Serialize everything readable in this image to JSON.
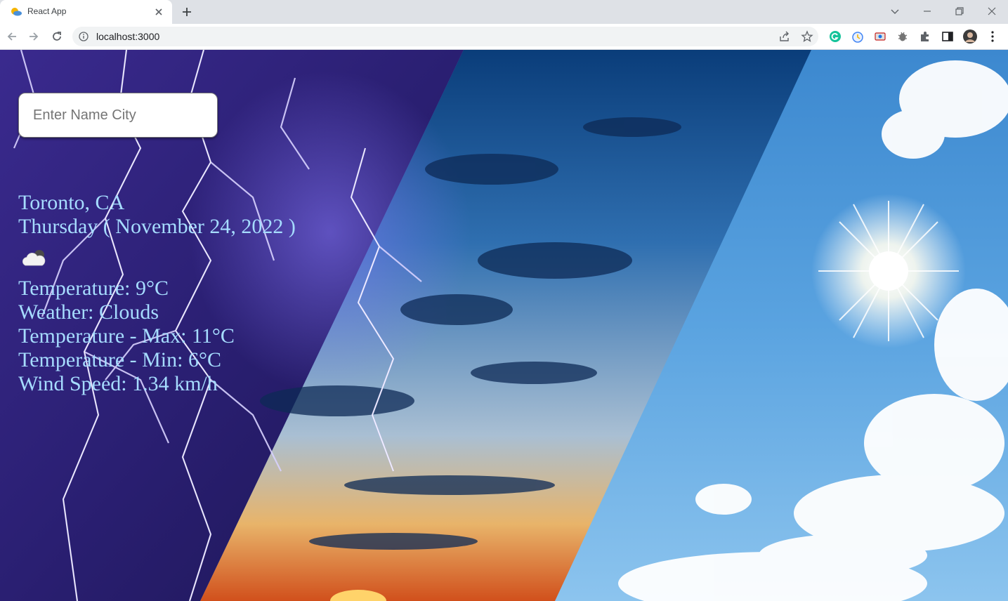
{
  "browser": {
    "tab_title": "React App",
    "url": "localhost:3000"
  },
  "search": {
    "placeholder": "Enter Name City",
    "value": ""
  },
  "weather": {
    "location": "Toronto, CA",
    "date": "Thursday ( November 24, 2022 )",
    "icon": "cloud-icon",
    "temperature": "Temperature: 9°C",
    "condition": "Weather: Clouds",
    "temp_max": "Temperature - Max: 11°C",
    "temp_min": "Temperature - Min: 6°C",
    "wind_speed": "Wind Speed: 1.34 km/h"
  },
  "colors": {
    "text": "#a6dcff",
    "storm": "#2a1f72",
    "sky": "#3f86c9",
    "sunny": "#5aa3e0"
  }
}
